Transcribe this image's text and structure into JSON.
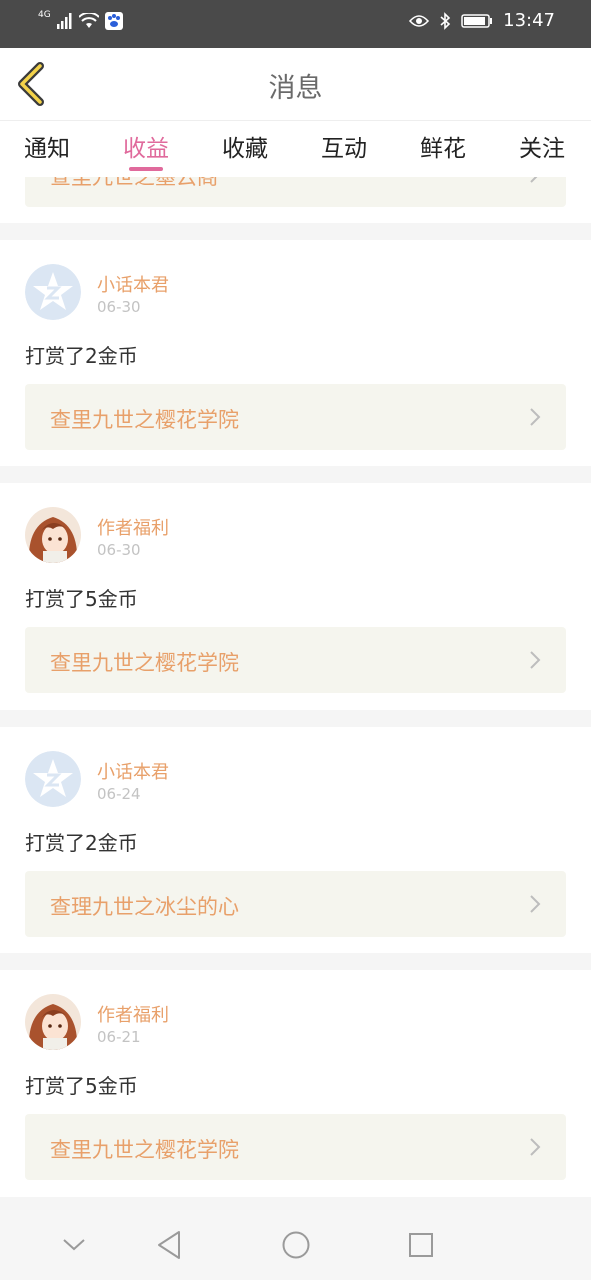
{
  "status_bar": {
    "signal": "4G",
    "time": "13:47"
  },
  "header": {
    "title": "消息"
  },
  "tabs": [
    {
      "label": "通知"
    },
    {
      "label": "收益"
    },
    {
      "label": "收藏"
    },
    {
      "label": "互动"
    },
    {
      "label": "鲜花"
    },
    {
      "label": "关注"
    }
  ],
  "active_tab": "收益",
  "partial_item": {
    "book": "查里九世之墨云阁"
  },
  "messages": [
    {
      "sender": "小话本君",
      "date": "06-30",
      "text": "打赏了2金币",
      "book": "查里九世之樱花学院",
      "avatar": "star-logo"
    },
    {
      "sender": "作者福利",
      "date": "06-30",
      "text": "打赏了5金币",
      "book": "查里九世之樱花学院",
      "avatar": "anime-girl"
    },
    {
      "sender": "小话本君",
      "date": "06-24",
      "text": "打赏了2金币",
      "book": "查理九世之冰尘的心",
      "avatar": "star-logo"
    },
    {
      "sender": "作者福利",
      "date": "06-21",
      "text": "打赏了5金币",
      "book": "查里九世之樱花学院",
      "avatar": "anime-girl"
    }
  ],
  "colors": {
    "accent": "#e06a9c",
    "link": "#e8a06a",
    "status_bar": "#4a4a4a"
  }
}
